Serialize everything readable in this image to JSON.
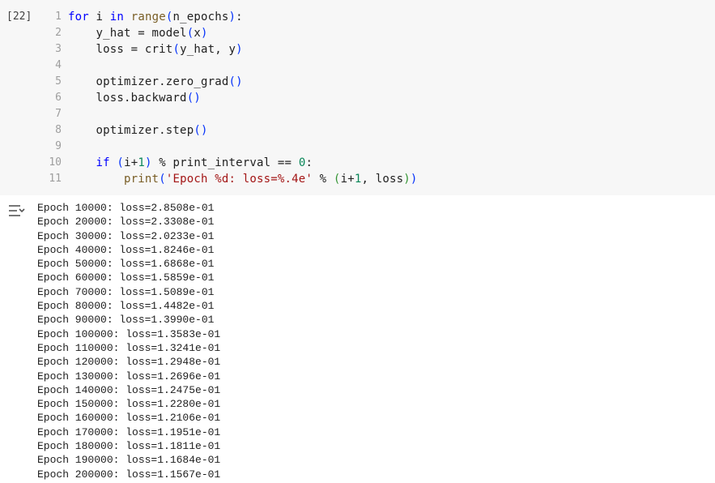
{
  "cell": {
    "execution_count": "[22]",
    "code_lines": [
      {
        "num": "1",
        "tokens": [
          {
            "t": "for",
            "c": "kw"
          },
          {
            "t": " i ",
            "c": "src"
          },
          {
            "t": "in",
            "c": "kw"
          },
          {
            "t": " ",
            "c": "src"
          },
          {
            "t": "range",
            "c": "bi"
          },
          {
            "t": "(",
            "c": "paren1"
          },
          {
            "t": "n_epochs",
            "c": "src"
          },
          {
            "t": ")",
            "c": "paren1"
          },
          {
            "t": ":",
            "c": "src"
          }
        ]
      },
      {
        "num": "2",
        "tokens": [
          {
            "t": "    y_hat = model",
            "c": "src"
          },
          {
            "t": "(",
            "c": "paren1"
          },
          {
            "t": "x",
            "c": "src"
          },
          {
            "t": ")",
            "c": "paren1"
          }
        ]
      },
      {
        "num": "3",
        "tokens": [
          {
            "t": "    loss = crit",
            "c": "src"
          },
          {
            "t": "(",
            "c": "paren1"
          },
          {
            "t": "y_hat, y",
            "c": "src"
          },
          {
            "t": ")",
            "c": "paren1"
          }
        ]
      },
      {
        "num": "4",
        "tokens": []
      },
      {
        "num": "5",
        "tokens": [
          {
            "t": "    optimizer.zero_grad",
            "c": "src"
          },
          {
            "t": "()",
            "c": "paren1"
          }
        ]
      },
      {
        "num": "6",
        "tokens": [
          {
            "t": "    loss.backward",
            "c": "src"
          },
          {
            "t": "()",
            "c": "paren1"
          }
        ]
      },
      {
        "num": "7",
        "tokens": []
      },
      {
        "num": "8",
        "tokens": [
          {
            "t": "    optimizer.step",
            "c": "src"
          },
          {
            "t": "()",
            "c": "paren1"
          }
        ]
      },
      {
        "num": "9",
        "tokens": []
      },
      {
        "num": "10",
        "tokens": [
          {
            "t": "    ",
            "c": "src"
          },
          {
            "t": "if",
            "c": "kw"
          },
          {
            "t": " ",
            "c": "src"
          },
          {
            "t": "(",
            "c": "paren1"
          },
          {
            "t": "i+",
            "c": "src"
          },
          {
            "t": "1",
            "c": "num"
          },
          {
            "t": ")",
            "c": "paren1"
          },
          {
            "t": " % print_interval == ",
            "c": "src"
          },
          {
            "t": "0",
            "c": "num"
          },
          {
            "t": ":",
            "c": "src"
          }
        ]
      },
      {
        "num": "11",
        "tokens": [
          {
            "t": "        ",
            "c": "src"
          },
          {
            "t": "print",
            "c": "bi"
          },
          {
            "t": "(",
            "c": "paren1"
          },
          {
            "t": "'Epoch %d: loss=%.4e'",
            "c": "str"
          },
          {
            "t": " % ",
            "c": "src"
          },
          {
            "t": "(",
            "c": "paren2"
          },
          {
            "t": "i+",
            "c": "src"
          },
          {
            "t": "1",
            "c": "num"
          },
          {
            "t": ", loss",
            "c": "src"
          },
          {
            "t": ")",
            "c": "paren2"
          },
          {
            "t": ")",
            "c": "paren1"
          }
        ]
      }
    ]
  },
  "output": {
    "icon": "output-toggle-icon",
    "lines": [
      "Epoch 10000: loss=2.8508e-01",
      "Epoch 20000: loss=2.3308e-01",
      "Epoch 30000: loss=2.0233e-01",
      "Epoch 40000: loss=1.8246e-01",
      "Epoch 50000: loss=1.6868e-01",
      "Epoch 60000: loss=1.5859e-01",
      "Epoch 70000: loss=1.5089e-01",
      "Epoch 80000: loss=1.4482e-01",
      "Epoch 90000: loss=1.3990e-01",
      "Epoch 100000: loss=1.3583e-01",
      "Epoch 110000: loss=1.3241e-01",
      "Epoch 120000: loss=1.2948e-01",
      "Epoch 130000: loss=1.2696e-01",
      "Epoch 140000: loss=1.2475e-01",
      "Epoch 150000: loss=1.2280e-01",
      "Epoch 160000: loss=1.2106e-01",
      "Epoch 170000: loss=1.1951e-01",
      "Epoch 180000: loss=1.1811e-01",
      "Epoch 190000: loss=1.1684e-01",
      "Epoch 200000: loss=1.1567e-01"
    ]
  },
  "colors": {
    "code_background": "#f7f7f7",
    "keyword": "#0000ff",
    "builtin": "#795e26",
    "string": "#a31515",
    "number": "#098658"
  }
}
